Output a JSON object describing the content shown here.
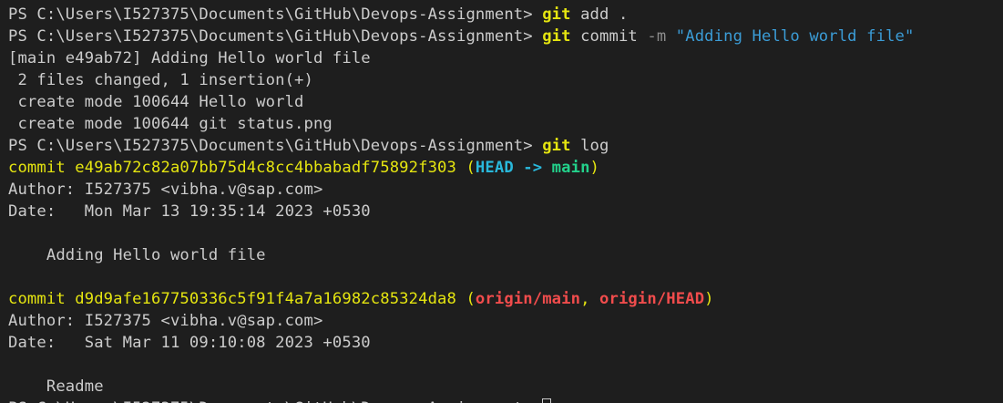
{
  "terminal": {
    "colors": {
      "background": "#1e1e1e",
      "foreground": "#cccccc",
      "yellow": "#e5e510",
      "cyan": "#29b8db",
      "green": "#23d18b",
      "red": "#f14c4c",
      "string_blue": "#3b9cd6"
    },
    "prompt": "PS C:\\Users\\I527375\\Documents\\GitHub\\Devops-Assignment> ",
    "lines": {
      "l0_git": "git",
      "l0_rest": " add .",
      "l1_git": "git",
      "l1_sub": " commit ",
      "l1_flag": "-m",
      "l1_msg": " \"Adding Hello world file\"",
      "commit_result": "[main e49ab72] Adding Hello world file",
      "files_changed": " 2 files changed, 1 insertion(+)",
      "create_1": " create mode 100644 Hello world",
      "create_2": " create mode 100644 git status.png",
      "l6_git": "git",
      "l6_rest": " log"
    },
    "log": [
      {
        "commit_label": "commit e49ab72c82a07bb75d4c8cc4bbabadf75892f303 ",
        "ref_open": "(",
        "ref_head": "HEAD -> ",
        "ref_main": "main",
        "ref_close": ")",
        "author": "Author: I527375 <vibha.v@sap.com>",
        "date": "Date:   Mon Mar 13 19:35:14 2023 +0530",
        "message": "    Adding Hello world file"
      },
      {
        "commit_label": "commit d9d9afe167750336c5f91f4a7a16982c85324da8 ",
        "ref_open": "(",
        "ref_origin_main": "origin/main",
        "ref_sep": ", ",
        "ref_origin_head": "origin/HEAD",
        "ref_close": ")",
        "author": "Author: I527375 <vibha.v@sap.com>",
        "date": "Date:   Sat Mar 11 09:10:08 2023 +0530",
        "message": "    Readme"
      }
    ]
  }
}
